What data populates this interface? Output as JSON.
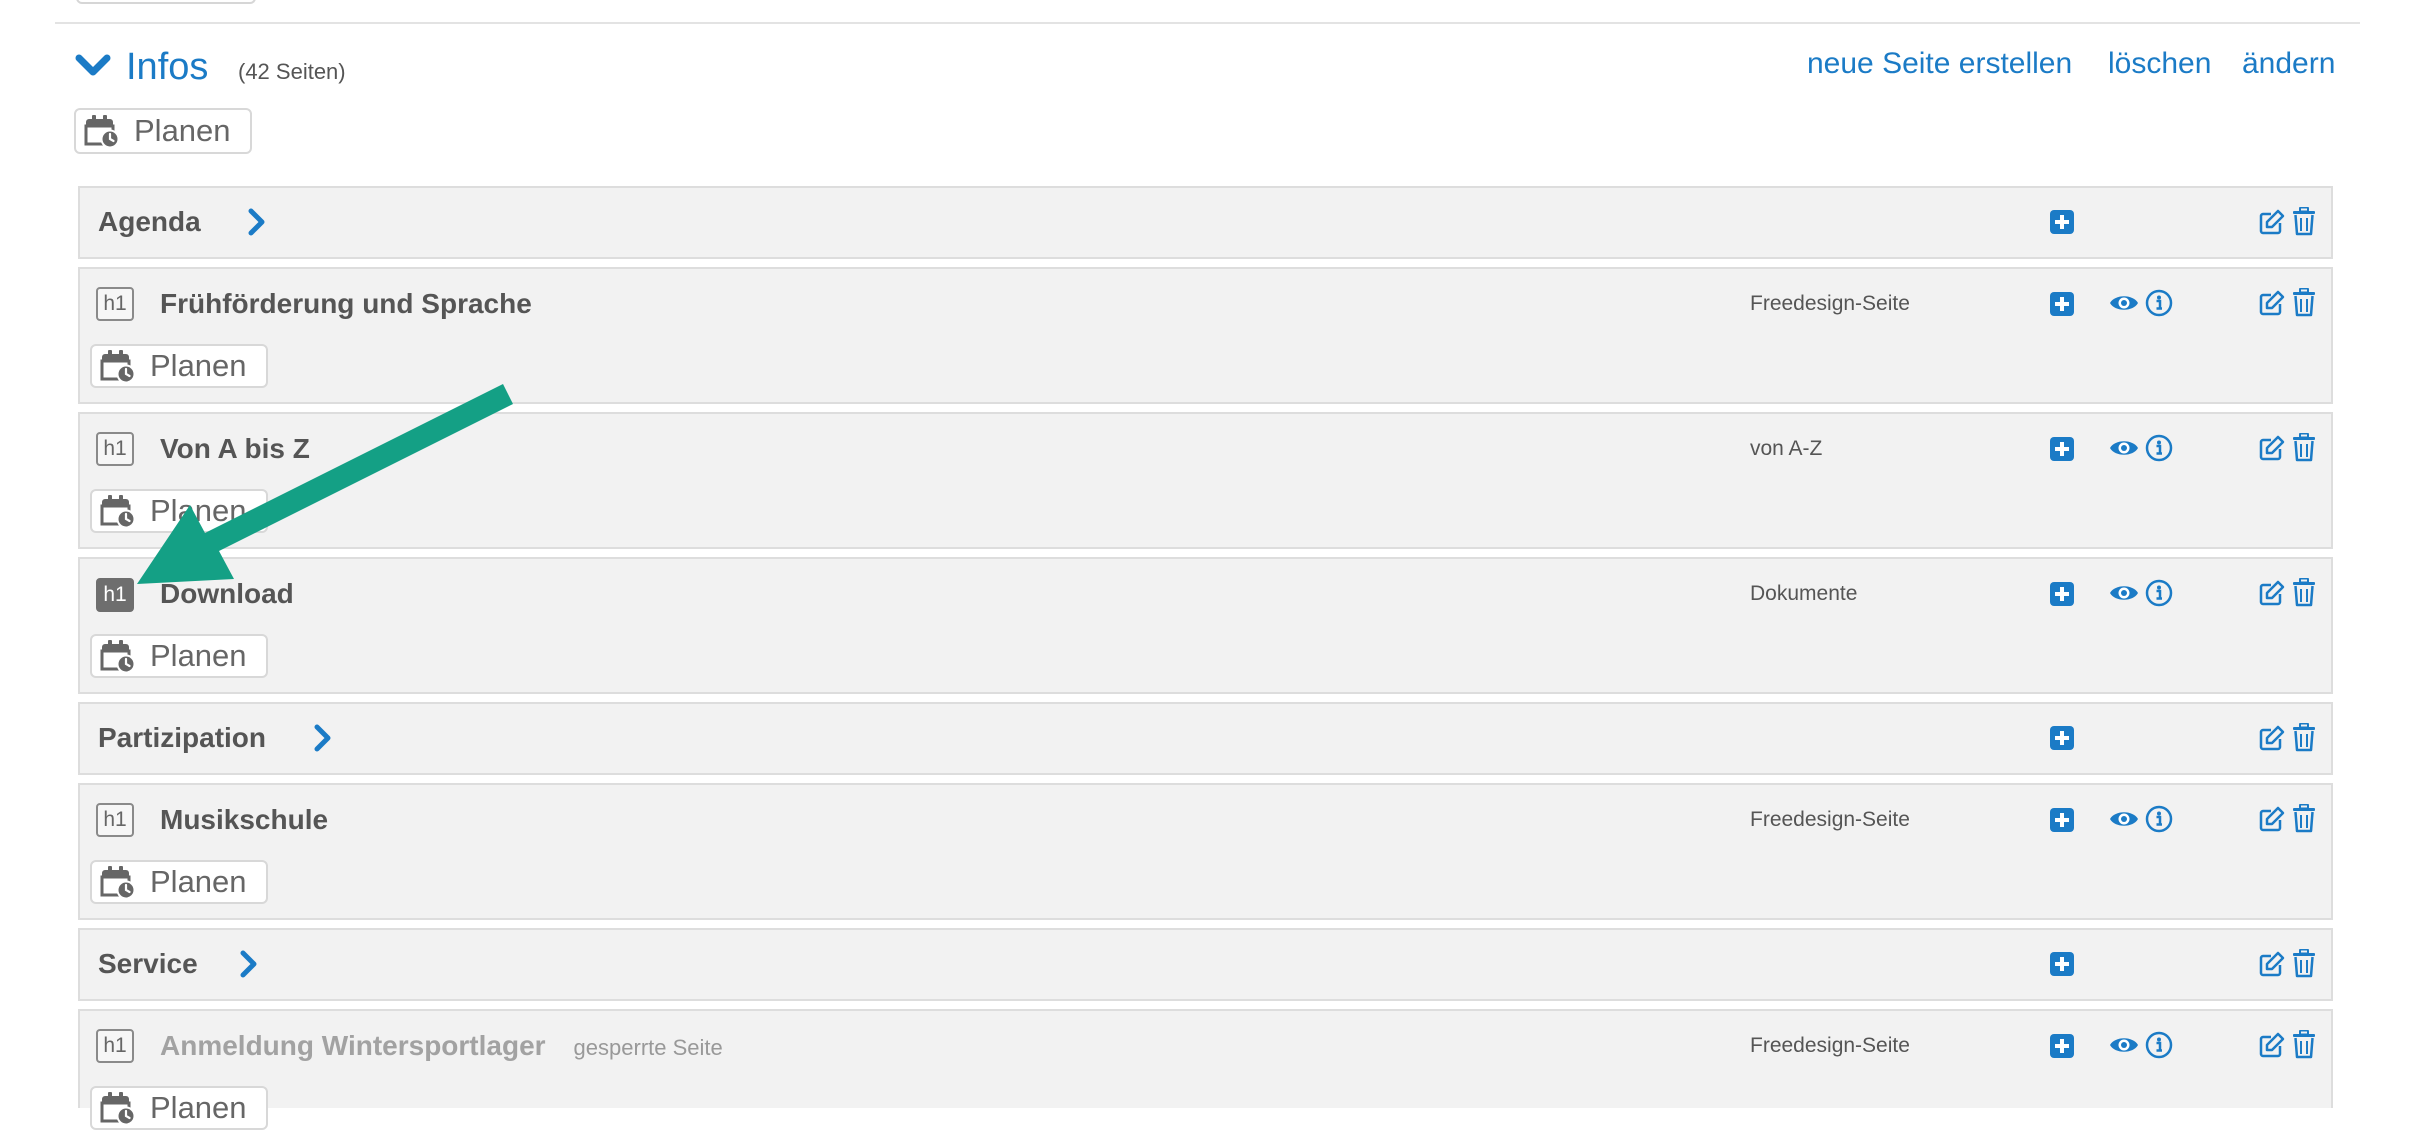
{
  "section": {
    "title": "Infos",
    "count": "(42 Seiten)",
    "links": {
      "new_page": "neue Seite erstellen",
      "delete": "löschen",
      "edit": "ändern"
    },
    "plan_label": "Planen"
  },
  "rows": [
    {
      "kind": "category",
      "title": "Agenda"
    },
    {
      "kind": "page",
      "badge": "h1",
      "title": "Frühförderung und Sprache",
      "type": "Freedesign-Seite",
      "plan_label": "Planen"
    },
    {
      "kind": "page",
      "badge": "h1",
      "title": "Von A bis Z",
      "type": "von A-Z",
      "plan_label": "Planen"
    },
    {
      "kind": "page",
      "badge": "h1",
      "title": "Download",
      "type": "Dokumente",
      "plan_label": "Planen",
      "badge_active": true
    },
    {
      "kind": "category",
      "title": "Partizipation"
    },
    {
      "kind": "page",
      "badge": "h1",
      "title": "Musikschule",
      "type": "Freedesign-Seite",
      "plan_label": "Planen"
    },
    {
      "kind": "category",
      "title": "Service"
    },
    {
      "kind": "page",
      "badge": "h1",
      "title": "Anmeldung Wintersportlager",
      "note": "gesperrte Seite",
      "type": "Freedesign-Seite",
      "plan_label": "Planen",
      "locked": true
    }
  ],
  "icons": {
    "add": "plus-square-icon",
    "preview": "eye-icon",
    "info": "info-circle-icon",
    "edit": "edit-icon",
    "delete": "trash-icon",
    "plan": "calendar-clock-icon",
    "expand": "chevron-right-icon",
    "collapse": "chevron-down-icon",
    "annotation": "arrow-annotation"
  },
  "colors": {
    "accent": "#1b7bc6",
    "row_bg": "#f2f2f2",
    "arrow": "#14a085",
    "badge_active": "#6e6e6e"
  }
}
